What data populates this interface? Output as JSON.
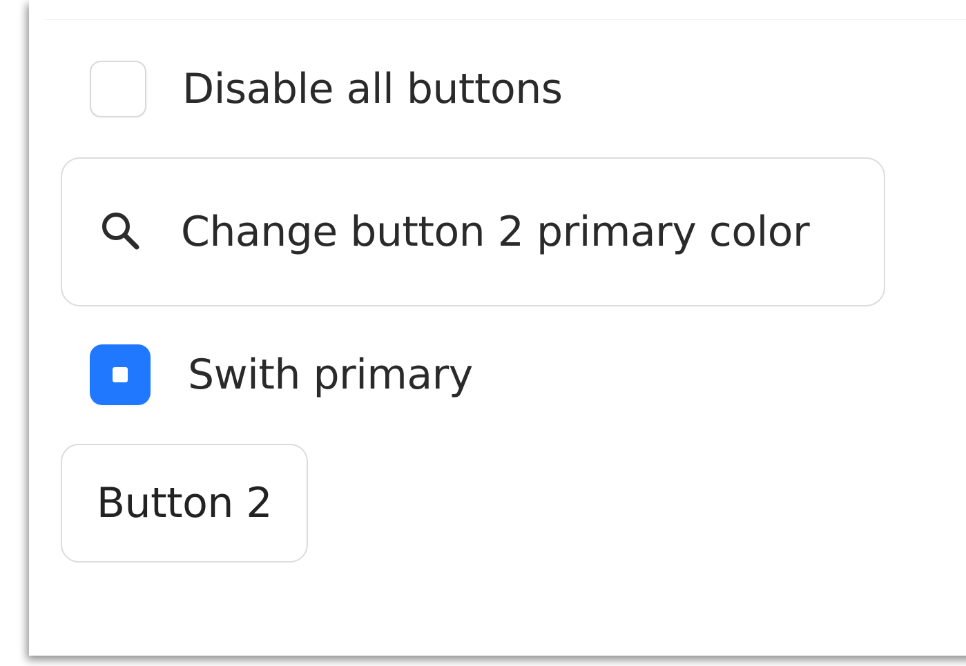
{
  "controls": {
    "disable_all": {
      "label": "Disable all buttons",
      "checked": false
    },
    "change_color_button": {
      "label": "Change button 2 primary color",
      "icon": "search-icon"
    },
    "switch_primary": {
      "label": "Swith primary",
      "checked": true
    },
    "button_2": {
      "label": "Button 2"
    }
  },
  "colors": {
    "accent": "#1f78ff",
    "border": "#dcdcdc",
    "text": "#2a2a2a"
  }
}
